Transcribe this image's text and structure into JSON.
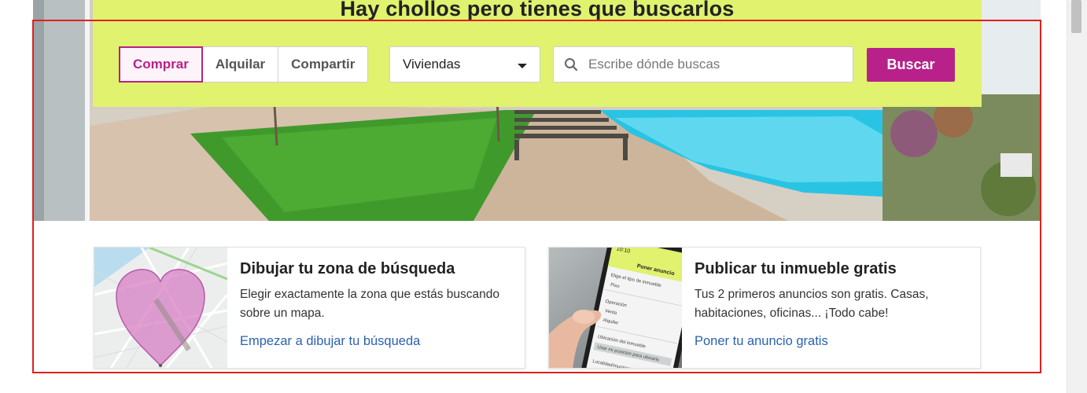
{
  "hero": {
    "title": "Hay chollos pero tienes que buscarlos"
  },
  "search": {
    "operations": [
      {
        "label": "Comprar",
        "active": true
      },
      {
        "label": "Alquilar",
        "active": false
      },
      {
        "label": "Compartir",
        "active": false
      }
    ],
    "property_type": "Viviendas",
    "placeholder": "Escribe dónde buscas",
    "submit_label": "Buscar"
  },
  "cards": [
    {
      "title": "Dibujar tu zona de búsqueda",
      "description": "Elegir exactamente la zona que estás buscando sobre un mapa.",
      "link": "Empezar a dibujar tu búsqueda",
      "image": "map-heart-illustration"
    },
    {
      "title": "Publicar tu inmueble gratis",
      "description": "Tus 2 primeros anuncios son gratis. Casas, habitaciones, oficinas... ¡Todo cabe!",
      "link": "Poner tu anuncio gratis",
      "image": "phone-app-photo",
      "phone_screen": {
        "time": "10:10",
        "header": "Poner anuncio",
        "lines": [
          "Elige el tipo de inmueble",
          "Piso",
          "Operación",
          "Venta",
          "Alquiler",
          "Ubicación del inmueble",
          "Usar mi posición para ubicarlo",
          "Localidad/municipio"
        ]
      }
    }
  ],
  "colors": {
    "accent": "#b8218a",
    "search_panel": "#e0f26e",
    "link": "#2a62b0",
    "highlight_frame": "#e0201d"
  }
}
